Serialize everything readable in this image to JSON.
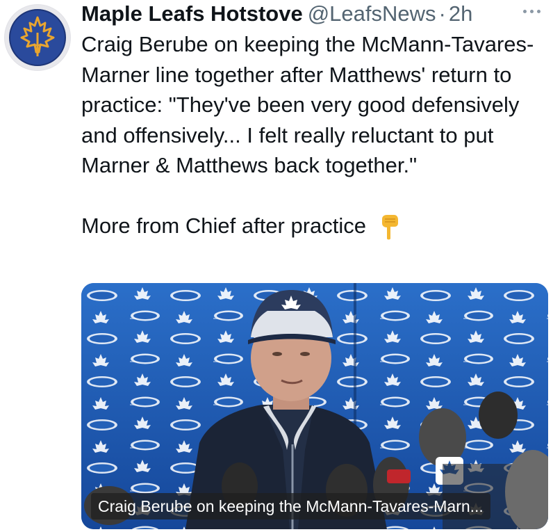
{
  "tweet": {
    "author_name": "Maple Leafs Hotstove",
    "handle": "@LeafsNews",
    "separator": "·",
    "time": "2h",
    "text_paragraph_1": "Craig Berube on keeping the McMann-Tavares-Marner line together after Matthews' return to practice: \"They've been very good defensively and offensively... I felt really reluctant to put Marner & Matthews back together.\"",
    "text_paragraph_2": "More from Chief after practice",
    "emoji_icon": "backhand-index-pointing-down"
  },
  "media": {
    "caption": "Craig Berube on keeping the McMann-Tavares-Marn..."
  },
  "colors": {
    "text": "#0f1419",
    "secondary_text": "#536471",
    "avatar_blue": "#2a4a9c",
    "avatar_gold": "#e8a530",
    "backdrop_blue": "#1f5fae"
  }
}
